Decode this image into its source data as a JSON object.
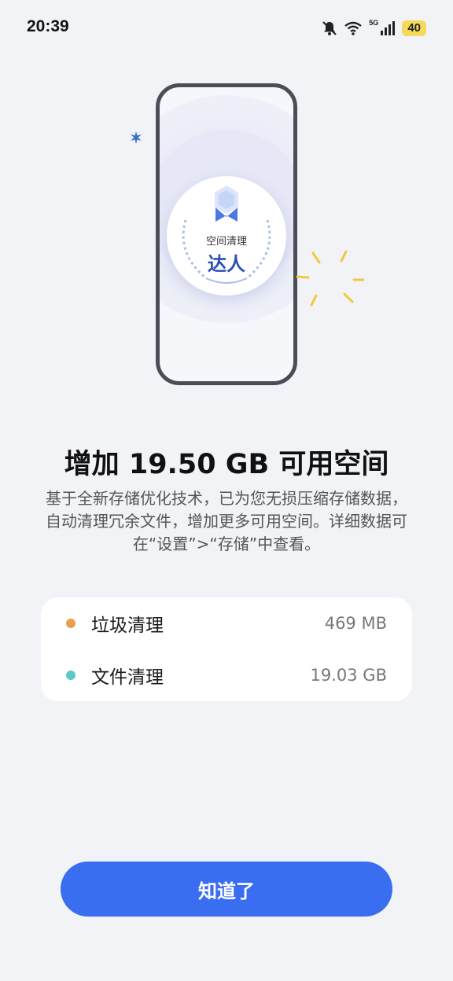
{
  "status_bar": {
    "time": "20:39",
    "network": "5G",
    "battery": "40"
  },
  "badge": {
    "title": "空间清理",
    "subtitle": "达人"
  },
  "headline": "增加 19.50 GB 可用空间",
  "description": "基于全新存储优化技术，已为您无损压缩存储数据，自动清理冗余文件，增加更多可用空间。详细数据可在“设置”>“存储”中查看。",
  "items": [
    {
      "label": "垃圾清理",
      "value": "469 MB",
      "dot_color": "#e8a04a"
    },
    {
      "label": "文件清理",
      "value": "19.03 GB",
      "dot_color": "#5cc9c9"
    }
  ],
  "confirm_button": "知道了",
  "colors": {
    "accent": "#3a6ef0",
    "badge_text": "#2d4fb3",
    "background": "#f1f3f6"
  }
}
